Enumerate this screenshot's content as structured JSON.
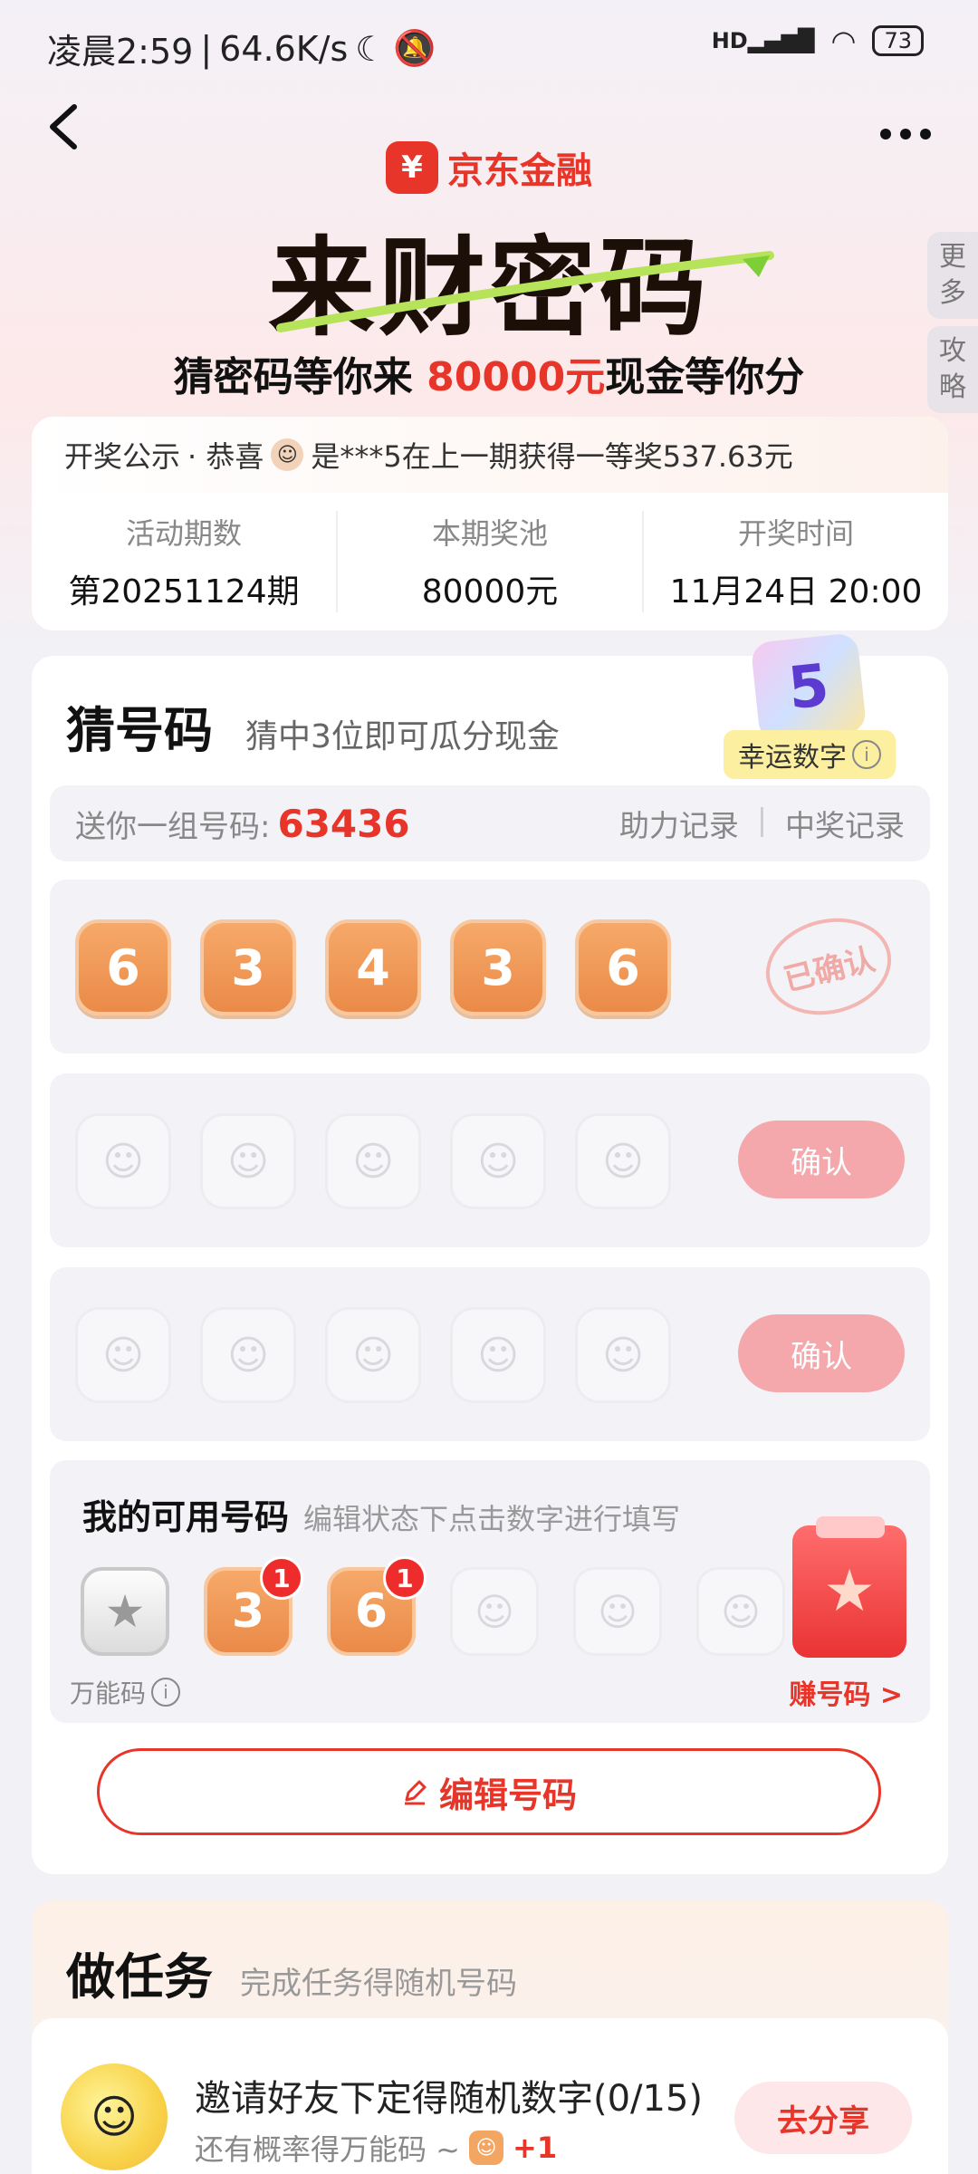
{
  "status_bar": {
    "time": "凌晨2:59",
    "speed": "64.6K/s",
    "network": "HD",
    "battery": "73"
  },
  "nav": {
    "back_icon": "chevron-left-icon",
    "more_icon": "more-dots-icon"
  },
  "brand": {
    "name": "京东金融"
  },
  "hero": {
    "title": "来财密码",
    "subtitle_before": "猜密码等你来 ",
    "subtitle_amount": "80000元",
    "subtitle_after": "现金等你分"
  },
  "side_tabs": {
    "more": "更多",
    "guide": "攻略"
  },
  "notice": {
    "label": "开奖公示",
    "text_before": "· 恭喜",
    "text_after": "是***5在上一期获得一等奖537.63元"
  },
  "info": {
    "period_label": "活动期数",
    "period_value": "第20251124期",
    "pool_label": "本期奖池",
    "pool_value": "80000元",
    "draw_label": "开奖时间",
    "draw_value": "11月24日 20:00"
  },
  "guess": {
    "title": "猜号码",
    "subtitle": "猜中3位即可瓜分现金",
    "lucky_number": "5",
    "lucky_label": "幸运数字",
    "gift_label": "送你一组号码:",
    "gift_code": "63436",
    "link_help": "助力记录",
    "link_win": "中奖记录",
    "row1": {
      "digits": [
        "6",
        "3",
        "4",
        "3",
        "6"
      ],
      "stamp": "已确认"
    },
    "row2": {
      "confirm": "确认"
    },
    "row3": {
      "confirm": "确认"
    },
    "empty_glyph": "☺"
  },
  "available": {
    "title": "我的可用号码",
    "subtitle": "编辑状态下点击数字进行填写",
    "wild_label": "万能码",
    "wild_glyph": "★",
    "tiles": [
      {
        "digit": "3",
        "count": "1"
      },
      {
        "digit": "6",
        "count": "1"
      }
    ],
    "earn_label": "赚号码 >",
    "earn_glyph": "★"
  },
  "edit_button": {
    "label": "编辑号码",
    "icon": "pencil-icon"
  },
  "tasks": {
    "title": "做任务",
    "subtitle": "完成任务得随机号码",
    "item": {
      "name": "邀请好友下定得随机数字(0/15)",
      "desc": "还有概率得万能码 ~",
      "plus": "+1",
      "button": "去分享"
    }
  },
  "colors": {
    "accent": "#e8352a",
    "tile_orange": "#ea8a48",
    "confirm_pink": "#f5a8ac"
  }
}
